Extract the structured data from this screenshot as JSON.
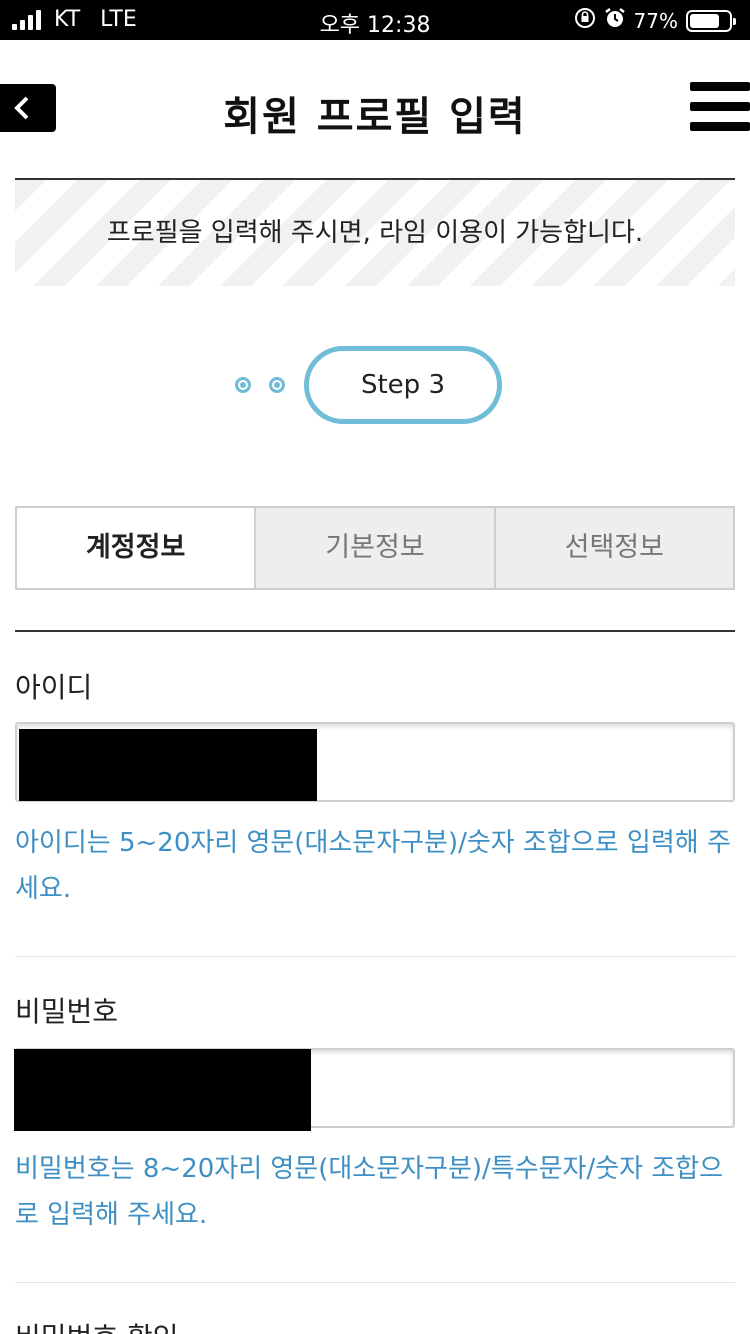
{
  "status_bar": {
    "carrier": "KT",
    "network": "LTE",
    "time": "오후 12:38",
    "icons": [
      "rotation-lock-icon",
      "alarm-icon"
    ],
    "battery_percent_text": "77%",
    "battery_level": 0.77
  },
  "header": {
    "title": "회원 프로필 입력",
    "back_icon": "chevron-left-icon",
    "menu_icon": "hamburger-menu-icon"
  },
  "notice": {
    "text": "프로필을 입력해 주시면, 라임 이용이 가능합니다."
  },
  "stepper": {
    "current_label": "Step 3",
    "accent_color": "#6fbdd6"
  },
  "tabs": [
    {
      "label": "계정정보",
      "active": true
    },
    {
      "label": "기본정보",
      "active": false
    },
    {
      "label": "선택정보",
      "active": false
    }
  ],
  "form": {
    "id_field": {
      "label": "아이디",
      "hint": "아이디는 5~20자리 영문(대소문자구분)/숫자 조합으로 입력해 주세요."
    },
    "password_field": {
      "label": "비밀번호",
      "hint": "비밀번호는 8~20자리 영문(대소문자구분)/특수문자/숫자 조합으로 입력해 주세요."
    },
    "password_confirm_field": {
      "label": "비밀번호 확인"
    }
  },
  "colors": {
    "hint_text": "#3d8fc4",
    "accent": "#6fbdd6"
  }
}
